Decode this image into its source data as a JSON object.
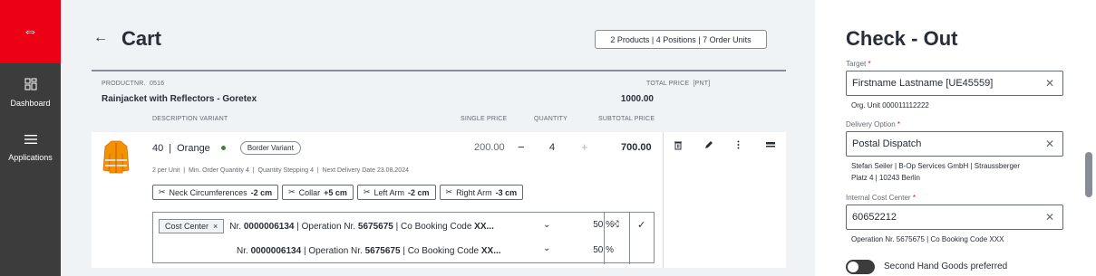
{
  "sidebar": {
    "brand_label": "⇔",
    "items": [
      {
        "label": "Dashboard",
        "icon": "dashboard-icon"
      },
      {
        "label": "Applications",
        "icon": "menu-icon"
      }
    ]
  },
  "header": {
    "title": "Cart",
    "summary": "2 Products | 4 Positions | 7 Order Units"
  },
  "product": {
    "productnr_label": "PRODUCTNR.",
    "productnr": "0516",
    "name": "Rainjacket with Reflectors - Goretex",
    "total_label": "TOTAL PRICE",
    "total_unit": "[PNT]",
    "total": "1000.00",
    "columns": {
      "description": "DESCRIPTION VARIANT",
      "single_price": "SINGLE PRICE",
      "quantity": "QUANTITY",
      "subtotal": "SUBTOTAL PRICE"
    }
  },
  "variant": {
    "size": "40",
    "separator": "|",
    "color": "Orange",
    "status_color": "#408335",
    "badge": "Border Variant",
    "single_price": "200.00",
    "quantity": "4",
    "subtotal": "700.00",
    "meta": {
      "per_unit": "2 per Unit",
      "min_order_label": "Min. Order Quantity",
      "min_order": "4",
      "stepping_label": "Quantity Stepping",
      "stepping": "4",
      "delivery_label": "Next Delivery Date",
      "delivery": "23.08.2024"
    },
    "alterations": [
      {
        "label": "Neck Circumferences",
        "value": "-2 cm"
      },
      {
        "label": "Collar",
        "value": "+5 cm"
      },
      {
        "label": "Left Arm",
        "value": "-2 cm"
      },
      {
        "label": "Right Arm",
        "value": "-3 cm"
      }
    ],
    "cost_center_tag": "Cost Center",
    "cost_rows": [
      {
        "nr_prefix": "Nr.",
        "nr": "0000006134",
        "op_prefix": "| Operation Nr.",
        "op": "5675675",
        "co_prefix": "| Co Booking Code",
        "co": "XX...",
        "pct": "50 %"
      },
      {
        "nr_prefix": "Nr.",
        "nr": "0000006134",
        "op_prefix": "| Operation Nr.",
        "op": "5675675",
        "co_prefix": "| Co Booking Code",
        "co": "XX...",
        "pct": "50 %"
      }
    ]
  },
  "checkout": {
    "title": "Check - Out",
    "target_label": "Target",
    "target_value": "Firstname Lastname [UE45559]",
    "org_unit_hint": "Org. Unit 000011112222",
    "delivery_label": "Delivery Option",
    "delivery_value": "Postal Dispatch",
    "address_line1": "Stefan Seiler | B-Op Services GmbH | Straussberger",
    "address_line2": "Platz 4 | 10243 Berlin",
    "cost_center_label": "Internal Cost Center",
    "cost_center_value": "60652212",
    "cost_center_hint": "Operation Nr. 5675675 | Co Booking Code XXX",
    "toggle_label": "Second Hand Goods preferred",
    "required_mark": "*"
  },
  "colors": {
    "brand": "#ec0016",
    "sidebar": "#3c3c3c",
    "background": "#f0f3f5"
  }
}
